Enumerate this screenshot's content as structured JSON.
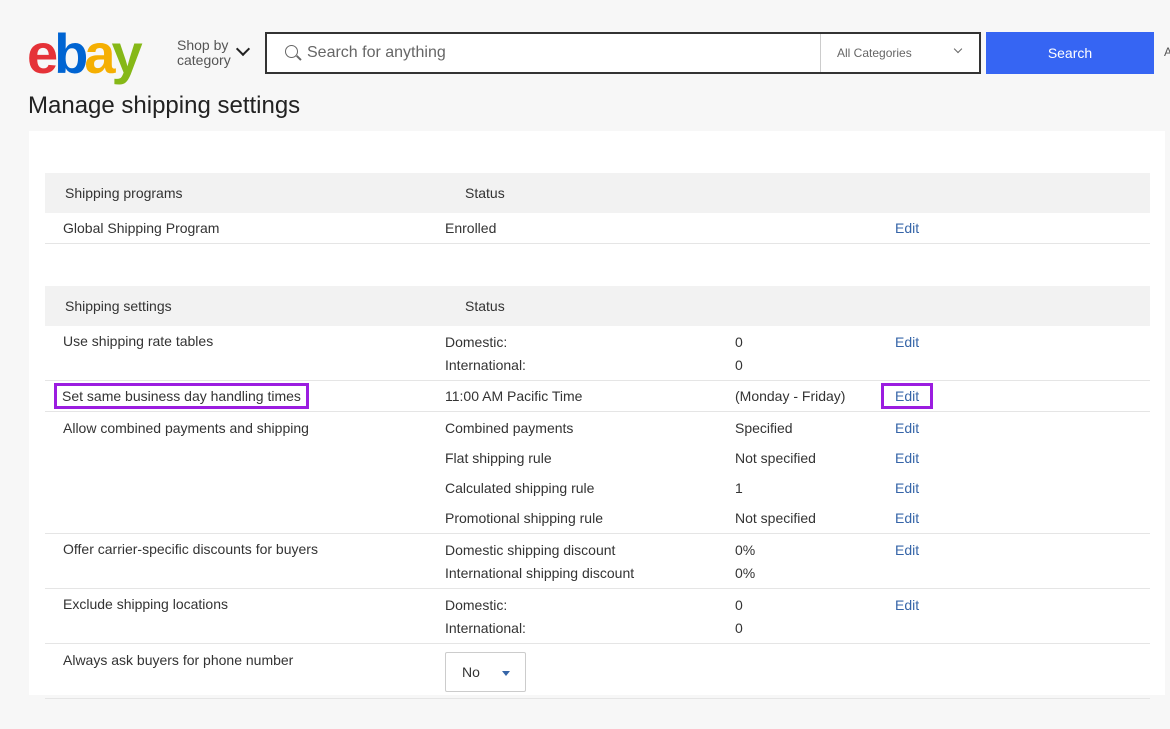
{
  "header": {
    "logo": "ebay",
    "logo_colors": [
      "#e53238",
      "#0064d2",
      "#f5af02",
      "#86b817"
    ],
    "shop_by_category": "Shop by category",
    "search_placeholder": "Search for anything",
    "category": "All Categories",
    "search_button": "Search",
    "advanced": "A"
  },
  "page_title": "Manage shipping settings",
  "programs": {
    "headers": [
      "Shipping programs",
      "Status"
    ],
    "rows": [
      {
        "name": "Global Shipping Program",
        "status": "Enrolled",
        "edit": "Edit"
      }
    ]
  },
  "settings": {
    "headers": [
      "Shipping settings",
      "Status"
    ],
    "rows": [
      {
        "name": "Use shipping rate tables",
        "lines": [
          {
            "label": "Domestic:",
            "value": "0",
            "edit": "Edit"
          },
          {
            "label": "International:",
            "value": "0"
          }
        ]
      },
      {
        "name": "Set same business day handling times",
        "highlight": true,
        "lines": [
          {
            "label": "11:00 AM Pacific Time",
            "value": "(Monday - Friday)",
            "edit": "Edit"
          }
        ]
      },
      {
        "name": "Allow combined payments and shipping",
        "lines": [
          {
            "label": "Combined payments",
            "value": "Specified",
            "edit": "Edit"
          },
          {
            "label": "Flat shipping rule",
            "value": "Not specified",
            "edit": "Edit"
          },
          {
            "label": "Calculated shipping rule",
            "value": "1",
            "edit": "Edit"
          },
          {
            "label": "Promotional shipping rule",
            "value": "Not specified",
            "edit": "Edit"
          }
        ]
      },
      {
        "name": "Offer carrier-specific discounts for buyers",
        "lines": [
          {
            "label": "Domestic shipping discount",
            "value": "0%",
            "edit": "Edit"
          },
          {
            "label": "International shipping discount",
            "value": "0%"
          }
        ]
      },
      {
        "name": "Exclude shipping locations",
        "lines": [
          {
            "label": "Domestic:",
            "value": "0",
            "edit": "Edit"
          },
          {
            "label": "International:",
            "value": "0"
          }
        ]
      }
    ],
    "phone": {
      "name": "Always ask buyers for phone number",
      "value": "No"
    }
  },
  "colors": {
    "accent": "#3665f3",
    "highlight": "#9b1de0",
    "link": "#3665a8"
  }
}
